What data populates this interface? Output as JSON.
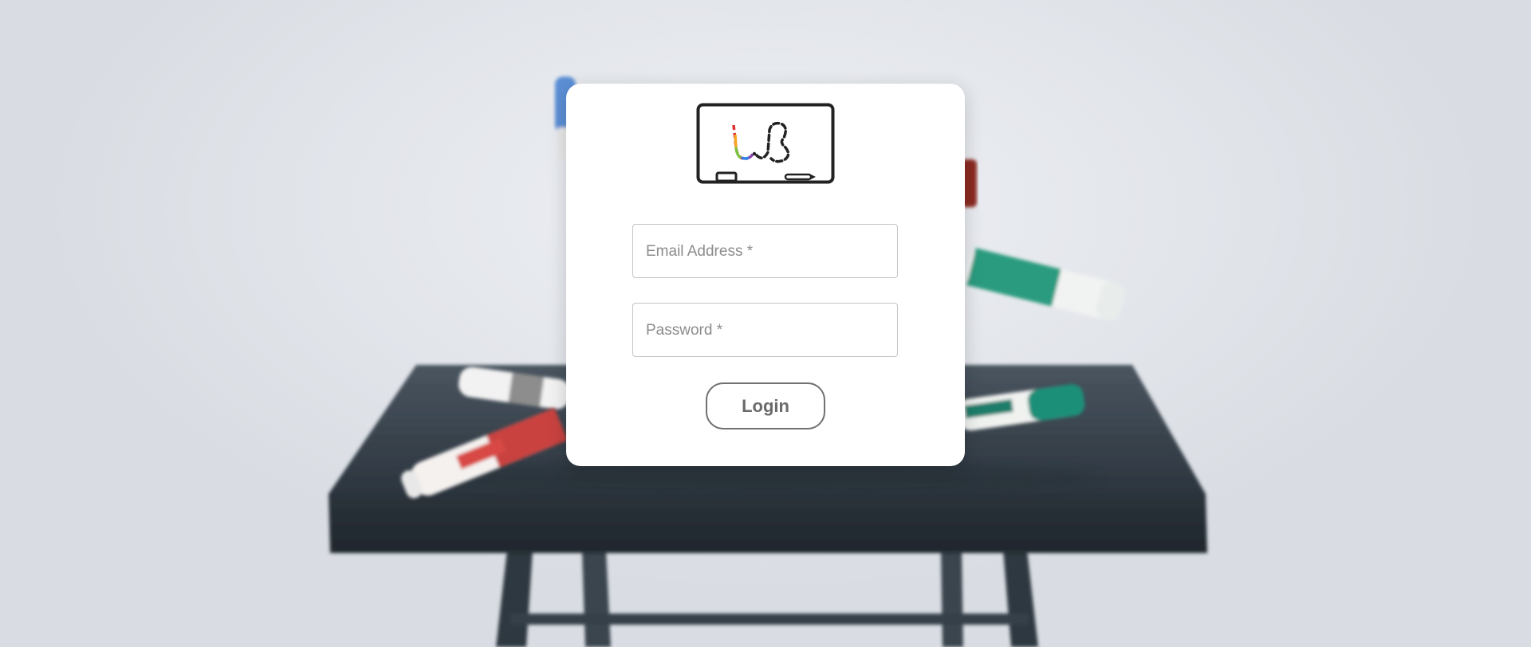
{
  "login_form": {
    "email_label": "Email Address *",
    "password_label": "Password *",
    "email_value": "",
    "password_value": "",
    "submit_label": "Login"
  },
  "logo": {
    "icon": "whiteboard-logo-icon",
    "colors": [
      "#e03131",
      "#f5a623",
      "#7cc242",
      "#2f80ed",
      "#8e44ad",
      "#222222"
    ]
  },
  "theme": {
    "card_background": "#ffffff",
    "field_border": "#c4c4c4",
    "button_border": "#707070"
  }
}
